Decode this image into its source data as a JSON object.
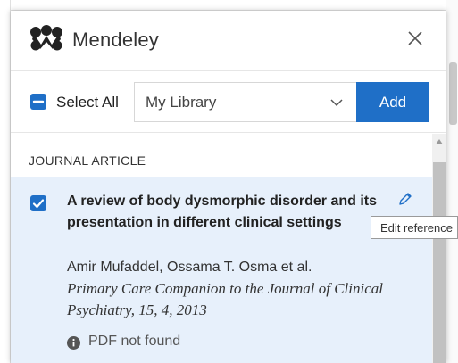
{
  "header": {
    "brand": "Mendeley",
    "close_icon": "close-icon"
  },
  "toolbar": {
    "select_all_label": "Select All",
    "library_value": "My Library",
    "add_label": "Add"
  },
  "results": {
    "section_title": "JOURNAL ARTICLE",
    "items": [
      {
        "title": "A review of body dysmorphic disorder and its presentation in different clinical settings",
        "authors": "Amir Mufaddel, Ossama T. Osma et al.",
        "journal": "Primary Care Companion to the Journal of Clinical Psychiatry, 15, 4, 2013",
        "pdf_status": "PDF not found",
        "selected": true
      }
    ]
  },
  "tooltip": {
    "text": "Edit reference"
  },
  "colors": {
    "accent": "#1f6fc7",
    "selected_row": "#e7f0fb"
  }
}
